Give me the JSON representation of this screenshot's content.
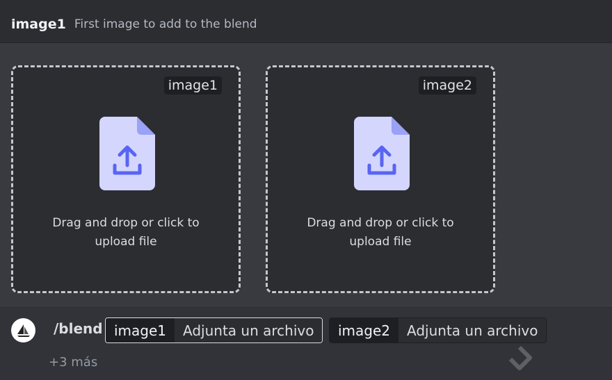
{
  "option": {
    "name": "image1",
    "description": "First image to add to the blend"
  },
  "dropzones": [
    {
      "tag": "image1",
      "text_line1": "Drag and drop or click to",
      "text_line2": "upload file",
      "icon": "file-upload-icon"
    },
    {
      "tag": "image2",
      "text_line1": "Drag and drop or click to",
      "text_line2": "upload file",
      "icon": "file-upload-icon"
    }
  ],
  "command": {
    "avatar_icon": "sailboat-icon",
    "name": "/blend",
    "params": [
      {
        "key": "image1",
        "value": "Adjunta un archivo",
        "active": true
      },
      {
        "key": "image2",
        "value": "Adjunta un archivo",
        "active": false
      }
    ],
    "more": "+3 más"
  },
  "colors": {
    "background": "#313338",
    "panel": "#383a40",
    "dropzone": "#2b2d31",
    "file_icon": "#d4d6fe",
    "file_icon_accent": "#5865f2"
  }
}
